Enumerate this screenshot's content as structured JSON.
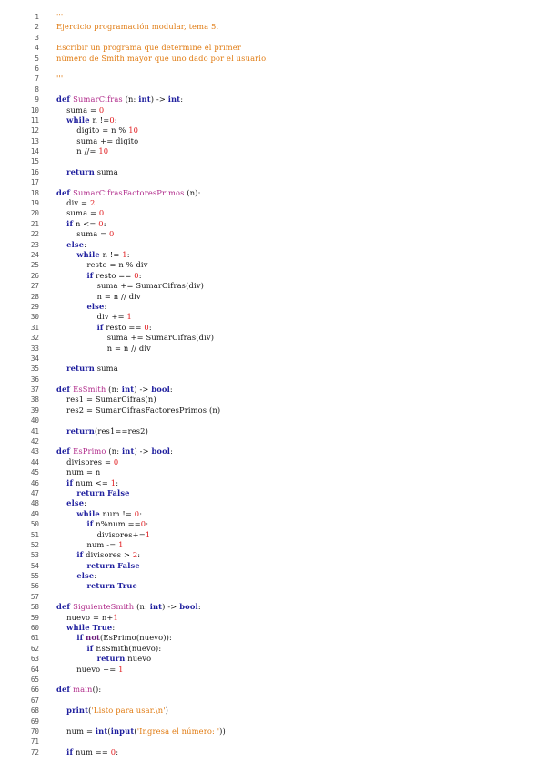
{
  "document": {
    "lines": [
      {
        "n": "1",
        "t": [
          [
            "'''",
            "str"
          ]
        ]
      },
      {
        "n": "2",
        "t": [
          [
            "Ejercicio programación modular, tema 5.",
            "str"
          ]
        ]
      },
      {
        "n": "3",
        "t": []
      },
      {
        "n": "4",
        "t": [
          [
            "Escribir un programa que determine el primer",
            "str"
          ]
        ]
      },
      {
        "n": "5",
        "t": [
          [
            "número de Smith mayor que uno dado por el usuario.",
            "str"
          ]
        ]
      },
      {
        "n": "6",
        "t": []
      },
      {
        "n": "7",
        "t": [
          [
            "'''",
            "str"
          ]
        ]
      },
      {
        "n": "8",
        "t": []
      },
      {
        "n": "9",
        "t": [
          [
            "def ",
            "kw"
          ],
          [
            "SumarCifras",
            "fn"
          ],
          [
            " (n: ",
            "tx"
          ],
          [
            "int",
            "kw"
          ],
          [
            ") -> ",
            "tx"
          ],
          [
            "int",
            "kw"
          ],
          [
            ":",
            "tx"
          ]
        ]
      },
      {
        "n": "10",
        "t": [
          [
            "    suma = ",
            "tx"
          ],
          [
            "0",
            "num"
          ]
        ]
      },
      {
        "n": "11",
        "t": [
          [
            "    ",
            "tx"
          ],
          [
            "while",
            "kw"
          ],
          [
            " n !=",
            "tx"
          ],
          [
            "0",
            "num"
          ],
          [
            ":",
            "tx"
          ]
        ]
      },
      {
        "n": "12",
        "t": [
          [
            "        digito = n % ",
            "tx"
          ],
          [
            "10",
            "num"
          ]
        ]
      },
      {
        "n": "13",
        "t": [
          [
            "        suma += digito",
            "tx"
          ]
        ]
      },
      {
        "n": "14",
        "t": [
          [
            "        n //= ",
            "tx"
          ],
          [
            "10",
            "num"
          ]
        ]
      },
      {
        "n": "15",
        "t": []
      },
      {
        "n": "16",
        "t": [
          [
            "    ",
            "tx"
          ],
          [
            "return",
            "kw"
          ],
          [
            " suma",
            "tx"
          ]
        ]
      },
      {
        "n": "17",
        "t": []
      },
      {
        "n": "18",
        "t": [
          [
            "def ",
            "kw"
          ],
          [
            "SumarCifrasFactoresPrimos",
            "fn"
          ],
          [
            " (n):",
            "tx"
          ]
        ]
      },
      {
        "n": "19",
        "t": [
          [
            "    div = ",
            "tx"
          ],
          [
            "2",
            "num"
          ]
        ]
      },
      {
        "n": "20",
        "t": [
          [
            "    suma = ",
            "tx"
          ],
          [
            "0",
            "num"
          ]
        ]
      },
      {
        "n": "21",
        "t": [
          [
            "    ",
            "tx"
          ],
          [
            "if",
            "kw"
          ],
          [
            " n <= ",
            "tx"
          ],
          [
            "0",
            "num"
          ],
          [
            ":",
            "tx"
          ]
        ]
      },
      {
        "n": "22",
        "t": [
          [
            "        suma = ",
            "tx"
          ],
          [
            "0",
            "num"
          ]
        ]
      },
      {
        "n": "23",
        "t": [
          [
            "    ",
            "tx"
          ],
          [
            "else",
            "kw"
          ],
          [
            ":",
            "tx"
          ]
        ]
      },
      {
        "n": "24",
        "t": [
          [
            "        ",
            "tx"
          ],
          [
            "while",
            "kw"
          ],
          [
            " n != ",
            "tx"
          ],
          [
            "1",
            "num"
          ],
          [
            ":",
            "tx"
          ]
        ]
      },
      {
        "n": "25",
        "t": [
          [
            "            resto = n % div",
            "tx"
          ]
        ]
      },
      {
        "n": "26",
        "t": [
          [
            "            ",
            "tx"
          ],
          [
            "if",
            "kw"
          ],
          [
            " resto == ",
            "tx"
          ],
          [
            "0",
            "num"
          ],
          [
            ":",
            "tx"
          ]
        ]
      },
      {
        "n": "27",
        "t": [
          [
            "                suma += SumarCifras(div)",
            "tx"
          ]
        ]
      },
      {
        "n": "28",
        "t": [
          [
            "                n = n // div",
            "tx"
          ]
        ]
      },
      {
        "n": "29",
        "t": [
          [
            "            ",
            "tx"
          ],
          [
            "else",
            "kw"
          ],
          [
            ":",
            "tx"
          ]
        ]
      },
      {
        "n": "30",
        "t": [
          [
            "                div += ",
            "tx"
          ],
          [
            "1",
            "num"
          ]
        ]
      },
      {
        "n": "31",
        "t": [
          [
            "                ",
            "tx"
          ],
          [
            "if",
            "kw"
          ],
          [
            " resto == ",
            "tx"
          ],
          [
            "0",
            "num"
          ],
          [
            ":",
            "tx"
          ]
        ]
      },
      {
        "n": "32",
        "t": [
          [
            "                    suma += SumarCifras(div)",
            "tx"
          ]
        ]
      },
      {
        "n": "33",
        "t": [
          [
            "                    n = n // div",
            "tx"
          ]
        ]
      },
      {
        "n": "34",
        "t": []
      },
      {
        "n": "35",
        "t": [
          [
            "    ",
            "tx"
          ],
          [
            "return",
            "kw"
          ],
          [
            " suma",
            "tx"
          ]
        ]
      },
      {
        "n": "36",
        "t": []
      },
      {
        "n": "37",
        "t": [
          [
            "def ",
            "kw"
          ],
          [
            "EsSmith",
            "fn"
          ],
          [
            " (n: ",
            "tx"
          ],
          [
            "int",
            "kw"
          ],
          [
            ") -> ",
            "tx"
          ],
          [
            "bool",
            "kw"
          ],
          [
            ":",
            "tx"
          ]
        ]
      },
      {
        "n": "38",
        "t": [
          [
            "    res1 = SumarCifras(n)",
            "tx"
          ]
        ]
      },
      {
        "n": "39",
        "t": [
          [
            "    res2 = SumarCifrasFactoresPrimos (n)",
            "tx"
          ]
        ]
      },
      {
        "n": "40",
        "t": []
      },
      {
        "n": "41",
        "t": [
          [
            "    ",
            "tx"
          ],
          [
            "return",
            "kw"
          ],
          [
            "(res1==res2)",
            "tx"
          ]
        ]
      },
      {
        "n": "42",
        "t": []
      },
      {
        "n": "43",
        "t": [
          [
            "def ",
            "kw"
          ],
          [
            "EsPrimo",
            "fn"
          ],
          [
            " (n: ",
            "tx"
          ],
          [
            "int",
            "kw"
          ],
          [
            ") -> ",
            "tx"
          ],
          [
            "bool",
            "kw"
          ],
          [
            ":",
            "tx"
          ]
        ]
      },
      {
        "n": "44",
        "t": [
          [
            "    divisores = ",
            "tx"
          ],
          [
            "0",
            "num"
          ]
        ]
      },
      {
        "n": "45",
        "t": [
          [
            "    num = n",
            "tx"
          ]
        ]
      },
      {
        "n": "46",
        "t": [
          [
            "    ",
            "tx"
          ],
          [
            "if",
            "kw"
          ],
          [
            " num <= ",
            "tx"
          ],
          [
            "1",
            "num"
          ],
          [
            ":",
            "tx"
          ]
        ]
      },
      {
        "n": "47",
        "t": [
          [
            "        ",
            "tx"
          ],
          [
            "return",
            "kw"
          ],
          [
            " ",
            "tx"
          ],
          [
            "False",
            "kw"
          ]
        ]
      },
      {
        "n": "48",
        "t": [
          [
            "    ",
            "tx"
          ],
          [
            "else",
            "kw"
          ],
          [
            ":",
            "tx"
          ]
        ]
      },
      {
        "n": "49",
        "t": [
          [
            "        ",
            "tx"
          ],
          [
            "while",
            "kw"
          ],
          [
            " num != ",
            "tx"
          ],
          [
            "0",
            "num"
          ],
          [
            ":",
            "tx"
          ]
        ]
      },
      {
        "n": "50",
        "t": [
          [
            "            ",
            "tx"
          ],
          [
            "if",
            "kw"
          ],
          [
            " n%num ==",
            "tx"
          ],
          [
            "0",
            "num"
          ],
          [
            ":",
            "tx"
          ]
        ]
      },
      {
        "n": "51",
        "t": [
          [
            "                divisores+=",
            "tx"
          ],
          [
            "1",
            "num"
          ]
        ]
      },
      {
        "n": "52",
        "t": [
          [
            "            num -= ",
            "tx"
          ],
          [
            "1",
            "num"
          ]
        ]
      },
      {
        "n": "53",
        "t": [
          [
            "        ",
            "tx"
          ],
          [
            "if",
            "kw"
          ],
          [
            " divisores > ",
            "tx"
          ],
          [
            "2",
            "num"
          ],
          [
            ":",
            "tx"
          ]
        ]
      },
      {
        "n": "54",
        "t": [
          [
            "            ",
            "tx"
          ],
          [
            "return",
            "kw"
          ],
          [
            " ",
            "tx"
          ],
          [
            "False",
            "kw"
          ]
        ]
      },
      {
        "n": "55",
        "t": [
          [
            "        ",
            "tx"
          ],
          [
            "else",
            "kw"
          ],
          [
            ":",
            "tx"
          ]
        ]
      },
      {
        "n": "56",
        "t": [
          [
            "            ",
            "tx"
          ],
          [
            "return",
            "kw"
          ],
          [
            " ",
            "tx"
          ],
          [
            "True",
            "kw"
          ]
        ]
      },
      {
        "n": "57",
        "t": []
      },
      {
        "n": "58",
        "t": [
          [
            "def ",
            "kw"
          ],
          [
            "SiguienteSmith",
            "fn"
          ],
          [
            " (n: ",
            "tx"
          ],
          [
            "int",
            "kw"
          ],
          [
            ") -> ",
            "tx"
          ],
          [
            "bool",
            "kw"
          ],
          [
            ":",
            "tx"
          ]
        ]
      },
      {
        "n": "59",
        "t": [
          [
            "    nuevo = n+",
            "tx"
          ],
          [
            "1",
            "num"
          ]
        ]
      },
      {
        "n": "60",
        "t": [
          [
            "    ",
            "tx"
          ],
          [
            "while",
            "kw"
          ],
          [
            " ",
            "tx"
          ],
          [
            "True",
            "kw"
          ],
          [
            ":",
            "tx"
          ]
        ]
      },
      {
        "n": "61",
        "t": [
          [
            "        ",
            "tx"
          ],
          [
            "if",
            "kw"
          ],
          [
            " ",
            "tx"
          ],
          [
            "not",
            "op"
          ],
          [
            "(EsPrimo(nuevo)):",
            "tx"
          ]
        ]
      },
      {
        "n": "62",
        "t": [
          [
            "            ",
            "tx"
          ],
          [
            "if",
            "kw"
          ],
          [
            " EsSmith(nuevo):",
            "tx"
          ]
        ]
      },
      {
        "n": "63",
        "t": [
          [
            "                ",
            "tx"
          ],
          [
            "return",
            "kw"
          ],
          [
            " nuevo",
            "tx"
          ]
        ]
      },
      {
        "n": "64",
        "t": [
          [
            "        nuevo += ",
            "tx"
          ],
          [
            "1",
            "num"
          ]
        ]
      },
      {
        "n": "65",
        "t": []
      },
      {
        "n": "66",
        "t": [
          [
            "def ",
            "kw"
          ],
          [
            "main",
            "fn"
          ],
          [
            "():",
            "tx"
          ]
        ]
      },
      {
        "n": "67",
        "t": []
      },
      {
        "n": "68",
        "t": [
          [
            "    ",
            "tx"
          ],
          [
            "print",
            "kw"
          ],
          [
            "(",
            "tx"
          ],
          [
            "'Listo para usar.\\n'",
            "str"
          ],
          [
            ")",
            "tx"
          ]
        ]
      },
      {
        "n": "69",
        "t": []
      },
      {
        "n": "70",
        "t": [
          [
            "    num = ",
            "tx"
          ],
          [
            "int",
            "kw"
          ],
          [
            "(",
            "tx"
          ],
          [
            "input",
            "kw"
          ],
          [
            "(",
            "tx"
          ],
          [
            "'Ingresa el número: '",
            "str"
          ],
          [
            "))",
            "tx"
          ]
        ]
      },
      {
        "n": "71",
        "t": []
      },
      {
        "n": "72",
        "t": [
          [
            "    ",
            "tx"
          ],
          [
            "if",
            "kw"
          ],
          [
            " num == ",
            "tx"
          ],
          [
            "0",
            "num"
          ],
          [
            ":",
            "tx"
          ]
        ]
      }
    ]
  }
}
